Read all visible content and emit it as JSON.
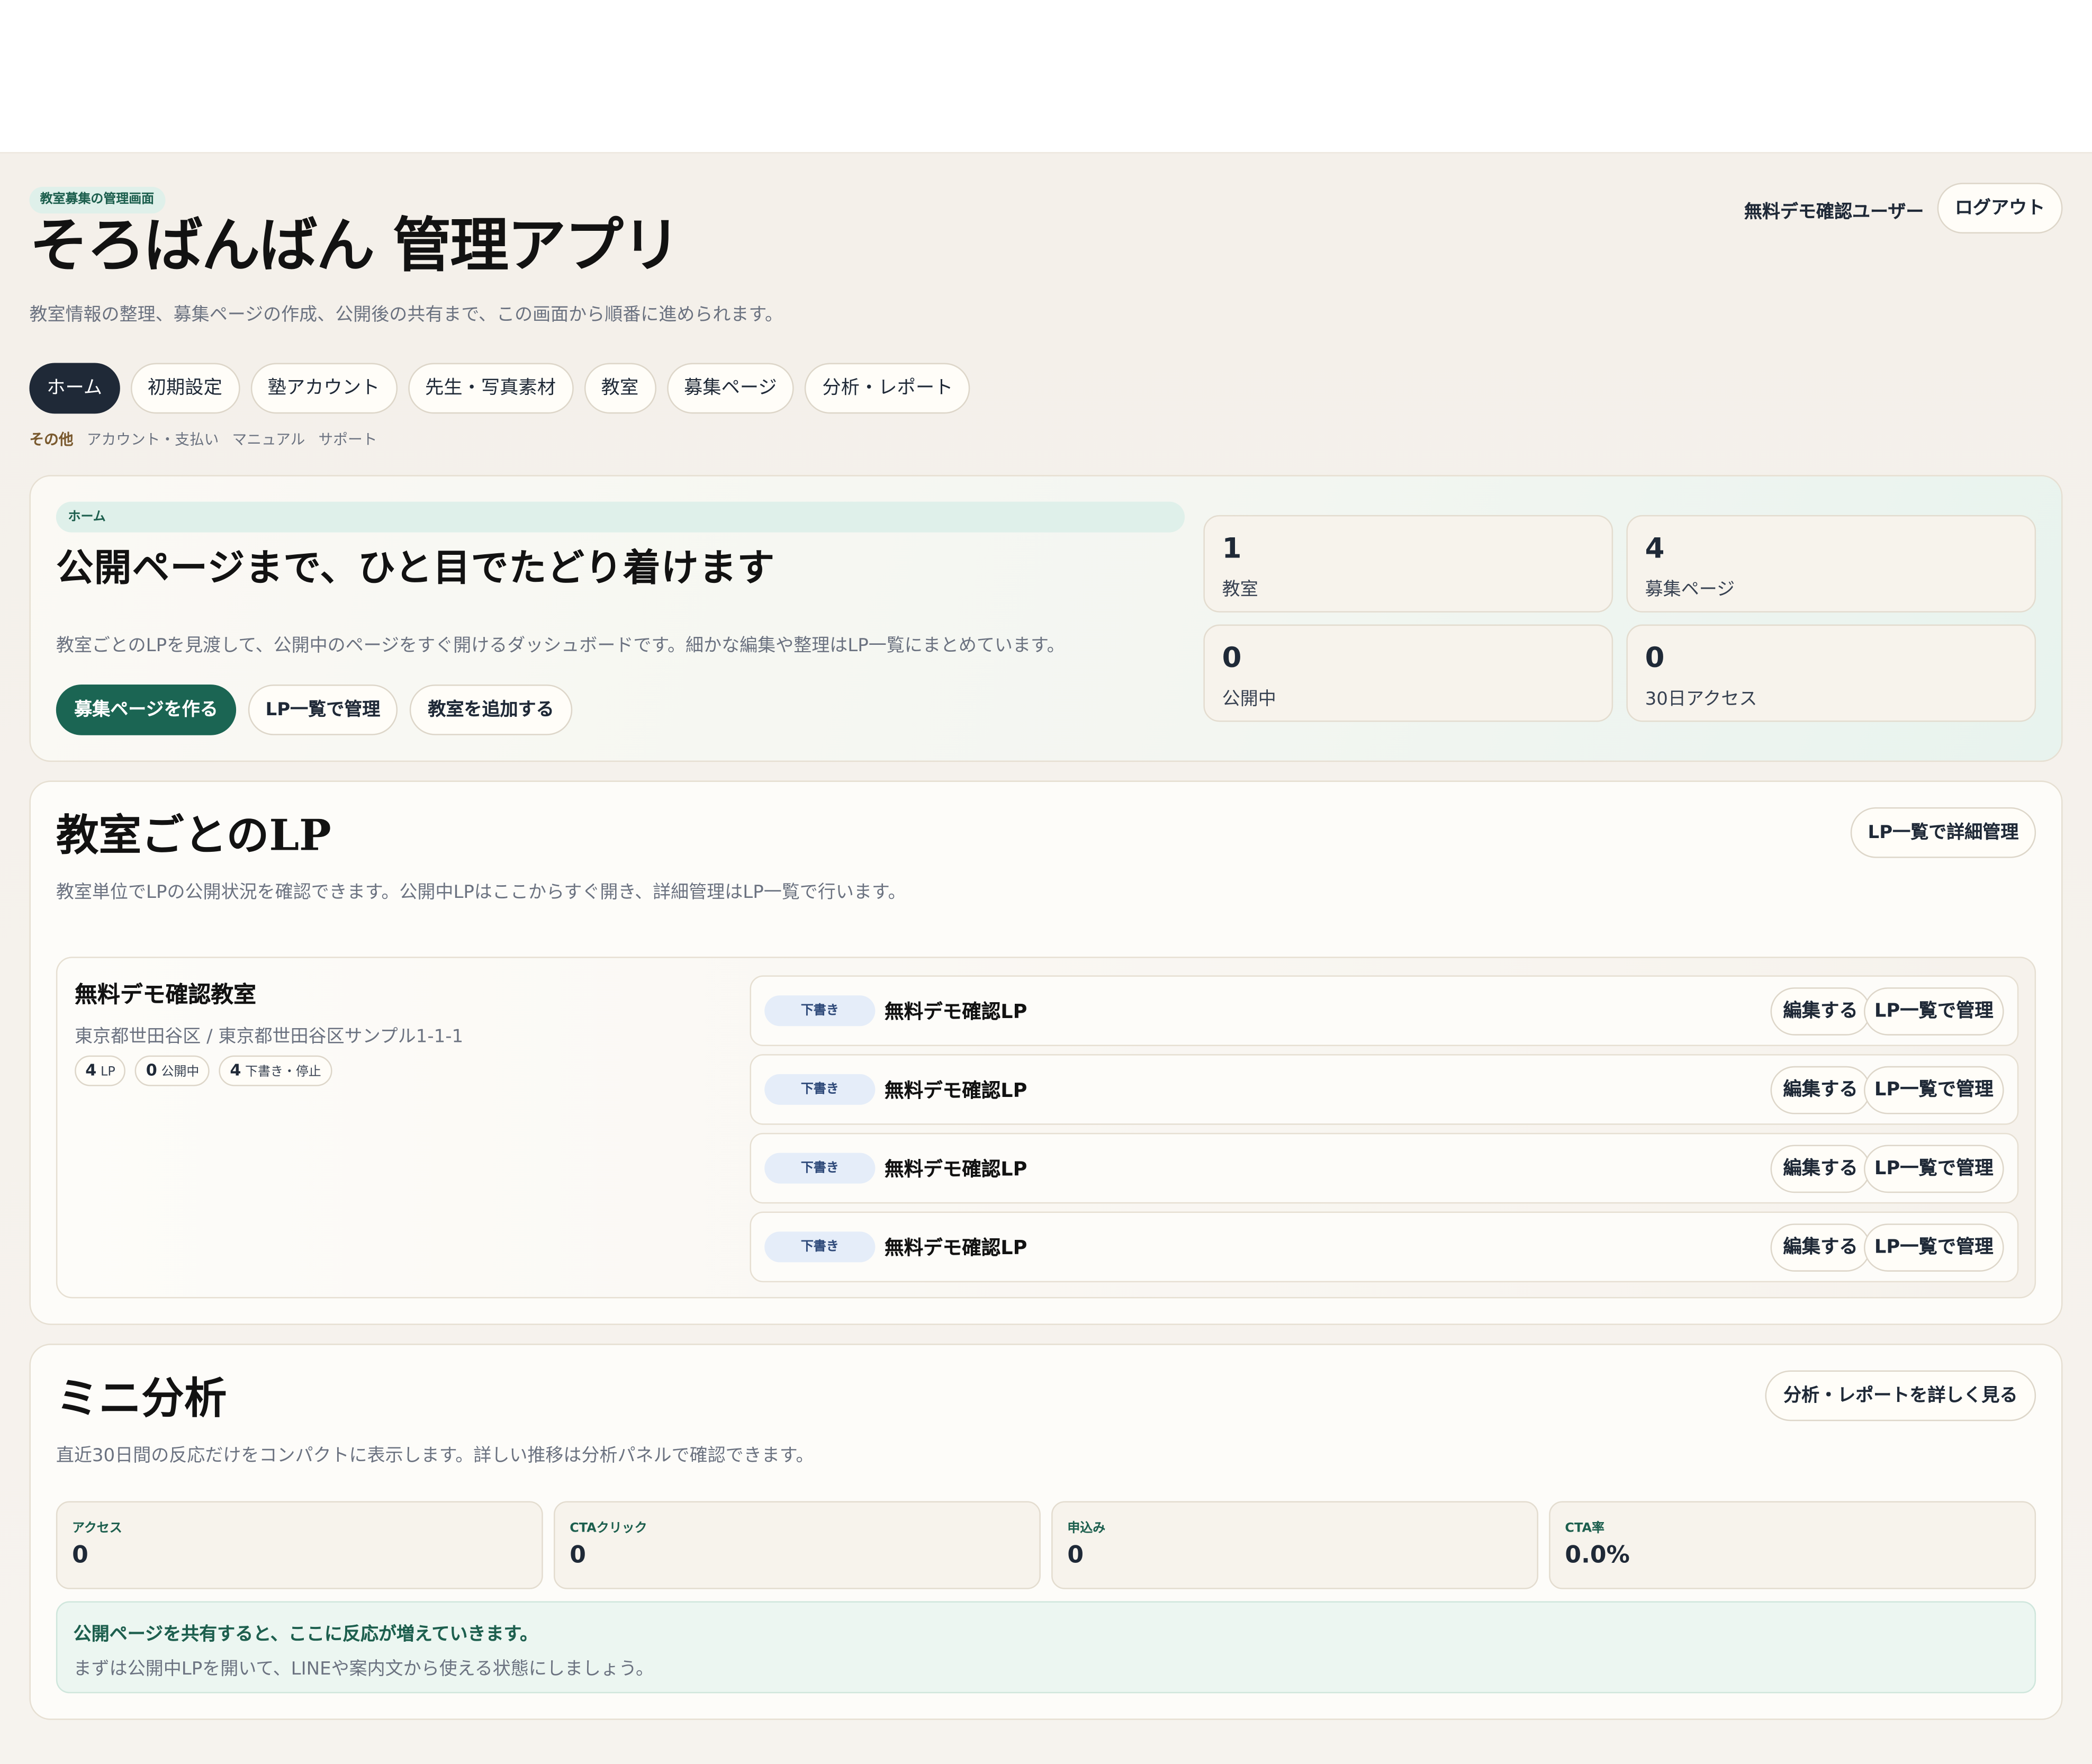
{
  "header": {
    "eyebrow": "教室募集の管理画面",
    "title": "そろばんばん 管理アプリ",
    "subtitle": "教室情報の整理、募集ページの作成、公開後の共有まで、この画面から順番に進められます。",
    "user_name": "無料デモ確認ユーザー",
    "logout_label": "ログアウト"
  },
  "tabs": [
    "ホーム",
    "初期設定",
    "塾アカウント",
    "先生・写真素材",
    "教室",
    "募集ページ",
    "分析・レポート"
  ],
  "sublinks": {
    "lead": "その他",
    "items": [
      "アカウント・支払い",
      "マニュアル",
      "サポート"
    ]
  },
  "hero": {
    "chip": "ホーム",
    "title": "公開ページまで、ひと目でたどり着けます",
    "description": "教室ごとのLPを見渡して、公開中のページをすぐ開けるダッシュボードです。細かな編集や整理はLP一覧にまとめています。",
    "primary_button": "募集ページを作る",
    "manage_button": "LP一覧で管理",
    "add_button": "教室を追加する",
    "stats": [
      {
        "value": "1",
        "label": "教室"
      },
      {
        "value": "4",
        "label": "募集ページ"
      },
      {
        "value": "0",
        "label": "公開中"
      },
      {
        "value": "0",
        "label": "30日アクセス"
      }
    ]
  },
  "lp_section": {
    "title": "教室ごとのLP",
    "description": "教室単位でLPの公開状況を確認できます。公開中LPはここからすぐ開き、詳細管理はLP一覧で行います。",
    "detail_button": "LP一覧で詳細管理",
    "classroom": {
      "name": "無料デモ確認教室",
      "address": "東京都世田谷区 / 東京都世田谷区サンプル1-1-1",
      "chips": [
        {
          "count": "4",
          "label": "LP"
        },
        {
          "count": "0",
          "label": "公開中"
        },
        {
          "count": "4",
          "label": "下書き・停止"
        }
      ],
      "lps": [
        {
          "status": "下書き",
          "title": "無料デモ確認LP",
          "edit": "編集する",
          "manage": "LP一覧で管理"
        },
        {
          "status": "下書き",
          "title": "無料デモ確認LP",
          "edit": "編集する",
          "manage": "LP一覧で管理"
        },
        {
          "status": "下書き",
          "title": "無料デモ確認LP",
          "edit": "編集する",
          "manage": "LP一覧で管理"
        },
        {
          "status": "下書き",
          "title": "無料デモ確認LP",
          "edit": "編集する",
          "manage": "LP一覧で管理"
        }
      ]
    }
  },
  "mini_analysis": {
    "title": "ミニ分析",
    "description": "直近30日間の反応だけをコンパクトに表示します。詳しい推移は分析パネルで確認できます。",
    "detail_button": "分析・レポートを詳しく見る",
    "metrics": [
      {
        "label": "アクセス",
        "value": "0"
      },
      {
        "label": "CTAクリック",
        "value": "0"
      },
      {
        "label": "申込み",
        "value": "0"
      },
      {
        "label": "CTA率",
        "value": "0.0%"
      }
    ],
    "notice_title": "公開ページを共有すると、ここに反応が増えていきます。",
    "notice_text": "まずは公開中LPを開いて、LINEや案内文から使える状態にしましょう。"
  },
  "colors": {
    "accent": "#1b6553",
    "dark": "#1f2937",
    "background": "#f4f0ea",
    "mint": "#dff0ea",
    "draft_badge": "#e5edf9"
  }
}
